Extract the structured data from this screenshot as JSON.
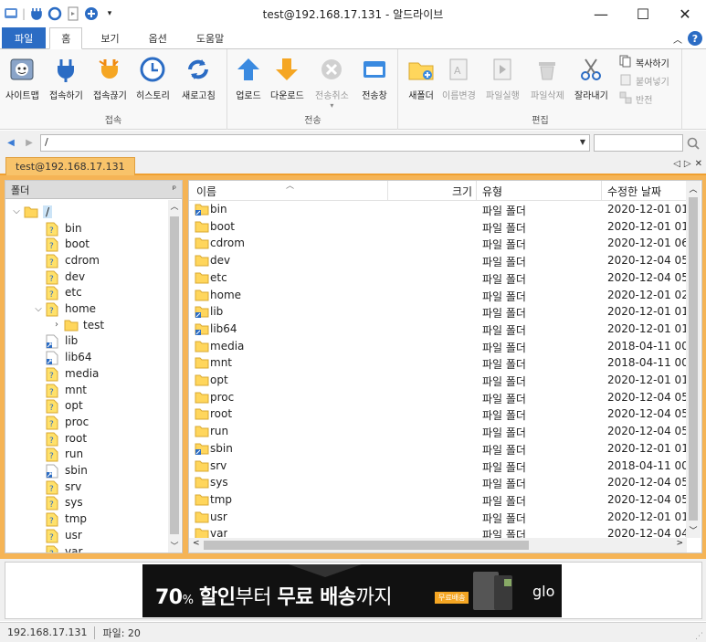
{
  "window": {
    "title": "test@192.168.17.131 - 알드라이브",
    "minimize": "—",
    "maximize": "☐",
    "close": "✕"
  },
  "ribbon_tabs": [
    "파일",
    "홈",
    "보기",
    "옵션",
    "도움말"
  ],
  "ribbon": {
    "groups": [
      "접속",
      "전송",
      "편집"
    ],
    "connect_buttons": [
      "사이트맵",
      "접속하기",
      "접속끊기",
      "히스토리",
      "새로고침"
    ],
    "transfer_buttons": [
      "업로드",
      "다운로드",
      "전송취소",
      "전송창"
    ],
    "edit_buttons": [
      "새폴더",
      "이름변경",
      "파일실행",
      "파일삭제",
      "잘라내기"
    ],
    "edit_small_buttons": [
      "복사하기",
      "붙여넣기",
      "반전"
    ],
    "help_label": "?"
  },
  "address": {
    "path": "/",
    "search_value": ""
  },
  "connection_tab": "test@192.168.17.131",
  "folder_pane": {
    "title": "폴더",
    "pin": "ᵖ",
    "tree": [
      {
        "name": "/",
        "level": 0,
        "expanded": true,
        "kind": "root"
      },
      {
        "name": "bin",
        "level": 1,
        "kind": "unknown"
      },
      {
        "name": "boot",
        "level": 1,
        "kind": "unknown"
      },
      {
        "name": "cdrom",
        "level": 1,
        "kind": "unknown"
      },
      {
        "name": "dev",
        "level": 1,
        "kind": "unknown"
      },
      {
        "name": "etc",
        "level": 1,
        "kind": "unknown"
      },
      {
        "name": "home",
        "level": 1,
        "expanded": true,
        "kind": "unknown"
      },
      {
        "name": "test",
        "level": 2,
        "collapsed": true,
        "kind": "folder"
      },
      {
        "name": "lib",
        "level": 1,
        "kind": "link"
      },
      {
        "name": "lib64",
        "level": 1,
        "kind": "link"
      },
      {
        "name": "media",
        "level": 1,
        "kind": "unknown"
      },
      {
        "name": "mnt",
        "level": 1,
        "kind": "unknown"
      },
      {
        "name": "opt",
        "level": 1,
        "kind": "unknown"
      },
      {
        "name": "proc",
        "level": 1,
        "kind": "unknown"
      },
      {
        "name": "root",
        "level": 1,
        "kind": "unknown"
      },
      {
        "name": "run",
        "level": 1,
        "kind": "unknown"
      },
      {
        "name": "sbin",
        "level": 1,
        "kind": "link"
      },
      {
        "name": "srv",
        "level": 1,
        "kind": "unknown"
      },
      {
        "name": "sys",
        "level": 1,
        "kind": "unknown"
      },
      {
        "name": "tmp",
        "level": 1,
        "kind": "unknown"
      },
      {
        "name": "usr",
        "level": 1,
        "kind": "unknown"
      },
      {
        "name": "var",
        "level": 1,
        "kind": "unknown"
      }
    ]
  },
  "file_list": {
    "columns": [
      "이름",
      "크기",
      "유형",
      "수정한 날짜"
    ],
    "rows": [
      {
        "name": "bin",
        "type": "파일 폴더",
        "date": "2020-12-01 01:",
        "link": true
      },
      {
        "name": "boot",
        "type": "파일 폴더",
        "date": "2020-12-01 01:",
        "link": false
      },
      {
        "name": "cdrom",
        "type": "파일 폴더",
        "date": "2020-12-01 06:",
        "link": false
      },
      {
        "name": "dev",
        "type": "파일 폴더",
        "date": "2020-12-04 05:",
        "link": false
      },
      {
        "name": "etc",
        "type": "파일 폴더",
        "date": "2020-12-04 05:",
        "link": false
      },
      {
        "name": "home",
        "type": "파일 폴더",
        "date": "2020-12-01 02:",
        "link": false
      },
      {
        "name": "lib",
        "type": "파일 폴더",
        "date": "2020-12-01 01:",
        "link": true
      },
      {
        "name": "lib64",
        "type": "파일 폴더",
        "date": "2020-12-01 01:",
        "link": true
      },
      {
        "name": "media",
        "type": "파일 폴더",
        "date": "2018-04-11 00:",
        "link": false
      },
      {
        "name": "mnt",
        "type": "파일 폴더",
        "date": "2018-04-11 00:",
        "link": false
      },
      {
        "name": "opt",
        "type": "파일 폴더",
        "date": "2020-12-01 01:",
        "link": false
      },
      {
        "name": "proc",
        "type": "파일 폴더",
        "date": "2020-12-04 05:",
        "link": false
      },
      {
        "name": "root",
        "type": "파일 폴더",
        "date": "2020-12-04 05:",
        "link": false
      },
      {
        "name": "run",
        "type": "파일 폴더",
        "date": "2020-12-04 05:",
        "link": false
      },
      {
        "name": "sbin",
        "type": "파일 폴더",
        "date": "2020-12-01 01:",
        "link": true
      },
      {
        "name": "srv",
        "type": "파일 폴더",
        "date": "2018-04-11 00:",
        "link": false
      },
      {
        "name": "sys",
        "type": "파일 폴더",
        "date": "2020-12-04 05:",
        "link": false
      },
      {
        "name": "tmp",
        "type": "파일 폴더",
        "date": "2020-12-04 05:",
        "link": false
      },
      {
        "name": "usr",
        "type": "파일 폴더",
        "date": "2020-12-01 01:",
        "link": false
      },
      {
        "name": "var",
        "type": "파일 폴더",
        "date": "2020-12-04 04:",
        "link": false
      }
    ]
  },
  "ad": {
    "percent": "70",
    "percent_unit": "%",
    "text1": "할인",
    "text2": "부터",
    "text3": "무료 배송",
    "text4": "까지",
    "badge": "무료배송",
    "brand": "glo"
  },
  "status": {
    "host": "192.168.17.131",
    "files": "파일: 20"
  },
  "colors": {
    "accent": "#2b6cc4",
    "frame_orange": "#f5b456",
    "tab_orange": "#f8c36a",
    "folder_yellow": "#ffd65c"
  }
}
